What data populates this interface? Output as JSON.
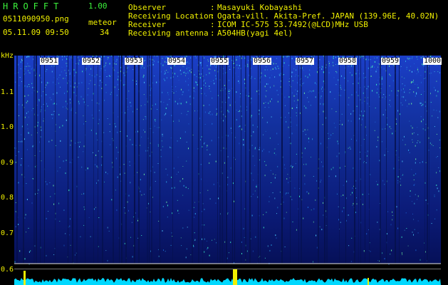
{
  "app": {
    "title": "HROFFT",
    "version": "1.00"
  },
  "file": {
    "name": "0511090950.png",
    "timestamp": "05.11.09 09:50"
  },
  "meteor": {
    "label": "meteor",
    "count": "34"
  },
  "info": [
    {
      "key": "Observer",
      "value": "Masayuki Kobayashi"
    },
    {
      "key": "Receiving Location",
      "value": "Ogata-vill. Akita-Pref. JAPAN (139.96E, 40.02N)"
    },
    {
      "key": "Receiver",
      "value": "ICOM IC-575 53.7492(@LCD)MHz USB"
    },
    {
      "key": "Receiving antenna",
      "value": "A504HB(yagi 4el)"
    }
  ],
  "separator": ":",
  "axis": {
    "unit": "kHz",
    "y_ticks": [
      "1.1",
      "1.0",
      "0.9",
      "0.8",
      "0.7",
      "0.6"
    ],
    "time_ticks": [
      "0951",
      "0952",
      "0953",
      "0954",
      "0955",
      "0956",
      "0957",
      "0958",
      "0959",
      "1000"
    ]
  },
  "colors": {
    "background": "#000000",
    "text_green": "#3cf23c",
    "text_yellow": "#f0f000",
    "spectrogram_base": "#0a1a8c",
    "spectrogram_hot": "#3cf0c8",
    "amplitude_trace": "#00e6ff",
    "meteor_spike": "#f0f000"
  }
}
